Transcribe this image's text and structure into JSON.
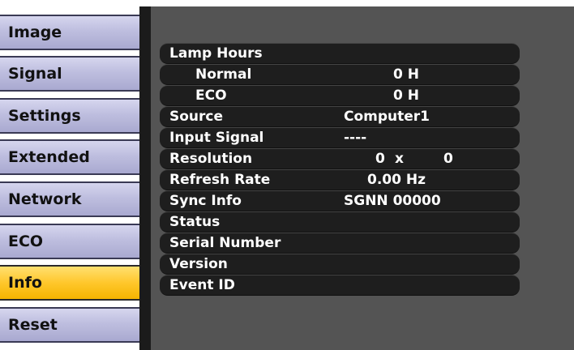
{
  "menu": {
    "items": [
      {
        "label": "Image"
      },
      {
        "label": "Signal"
      },
      {
        "label": "Settings"
      },
      {
        "label": "Extended"
      },
      {
        "label": "Network"
      },
      {
        "label": "ECO"
      },
      {
        "label": "Info"
      },
      {
        "label": "Reset"
      }
    ],
    "active": "Info"
  },
  "info": {
    "lamp_hours_label": "Lamp Hours",
    "normal_label": "Normal",
    "normal_value": "0 H",
    "eco_label": "ECO",
    "eco_value": "0 H",
    "source_label": "Source",
    "source_value": "Computer1",
    "input_signal_label": "Input Signal",
    "input_signal_value": "----",
    "resolution_label": "Resolution",
    "resolution_w": "0",
    "resolution_x": "x",
    "resolution_h": "0",
    "refresh_rate_label": "Refresh Rate",
    "refresh_rate_value": "0.00 Hz",
    "sync_info_label": "Sync Info",
    "sync_info_value": "SGNN 00000",
    "status_label": "Status",
    "serial_number_label": "Serial Number",
    "version_label": "Version",
    "event_id_label": "Event ID"
  },
  "colors": {
    "menu_bg": "#bebedf",
    "menu_active": "#ffc72c",
    "panel_bg": "#545454",
    "row_bg": "#1e1e1e"
  }
}
